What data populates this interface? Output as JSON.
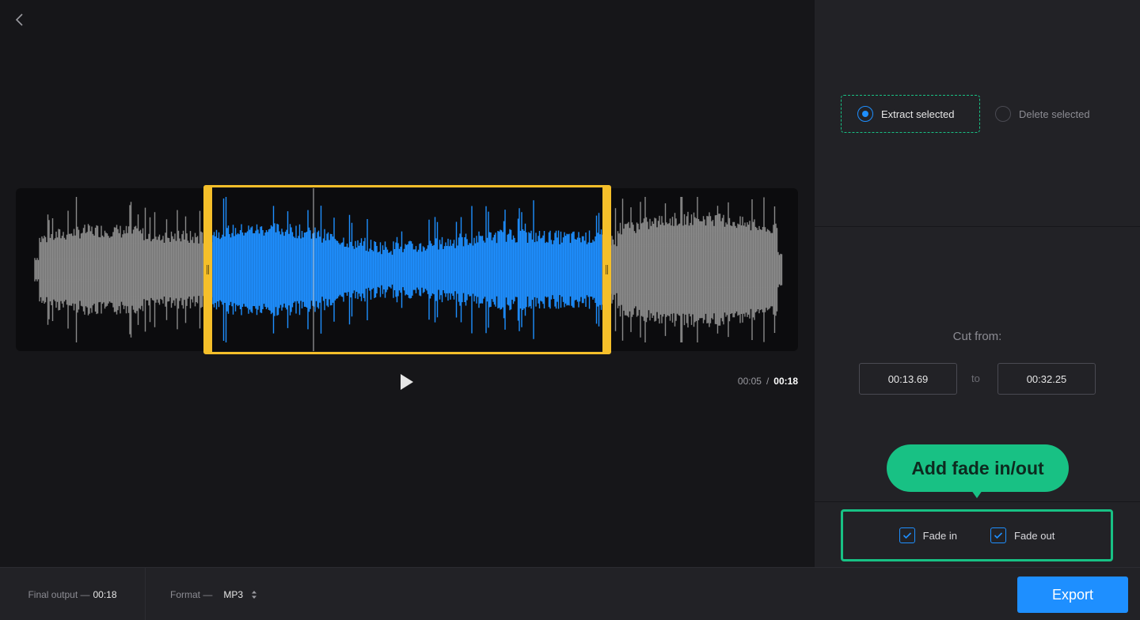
{
  "editor": {
    "back_icon": "chevron-left-icon",
    "play_icon": "play-icon",
    "current_time": "00:05",
    "time_separator": "/",
    "total_time": "00:18",
    "colors": {
      "waveform_unselected": "#8a8a8a",
      "waveform_selected": "#1e8fff",
      "selection_frame": "#f5bf2a",
      "playhead": "#bdbdbd"
    }
  },
  "mode": {
    "options": [
      {
        "label": "Extract selected",
        "selected": true
      },
      {
        "label": "Delete selected",
        "selected": false
      }
    ]
  },
  "cut": {
    "title": "Cut from:",
    "from_value": "00:13.69",
    "to_word": "to",
    "to_value": "00:32.25"
  },
  "callout": {
    "text": "Add fade in/out",
    "color": "#18c184"
  },
  "fade": {
    "fade_in_label": "Fade in",
    "fade_in_checked": true,
    "fade_out_label": "Fade out",
    "fade_out_checked": true
  },
  "bottom": {
    "output_label": "Final output —",
    "output_value": "00:18",
    "format_label": "Format —",
    "format_value": "MP3",
    "export_label": "Export",
    "accent": "#1e8fff"
  }
}
